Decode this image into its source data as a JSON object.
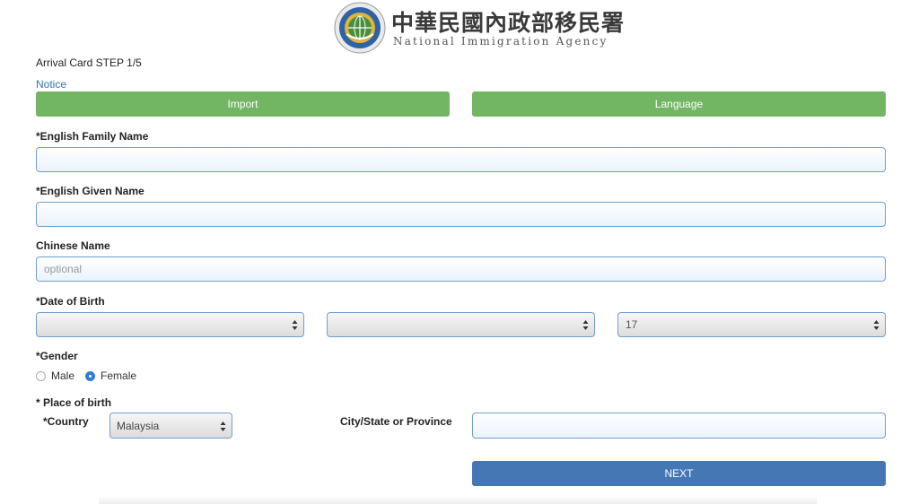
{
  "header": {
    "agency_name_zh": "中華民國內政部移民署",
    "agency_name_en": "National Immigration Agency",
    "logo_icon": "national-immigration-agency-seal-icon",
    "colors": {
      "seal_blue": "#2f63a8",
      "seal_gold": "#e2b53a",
      "seal_green": "#4a8d3c"
    }
  },
  "form": {
    "step": "Arrival Card STEP 1/5",
    "notice_link": "Notice",
    "import_button": "Import",
    "language_button": "Language",
    "family_name": {
      "label": "*English Family Name",
      "value": "",
      "placeholder": ""
    },
    "given_name": {
      "label": "*English Given Name",
      "value": "",
      "placeholder": ""
    },
    "chinese_name": {
      "label": "Chinese Name",
      "value": "",
      "placeholder": "optional"
    },
    "dob": {
      "label": "*Date of Birth",
      "year": "",
      "month": "",
      "day": "17"
    },
    "gender": {
      "label": "*Gender",
      "options": [
        {
          "label": "Male",
          "selected": false
        },
        {
          "label": "Female",
          "selected": true
        }
      ]
    },
    "place_of_birth": {
      "label": "* Place of birth",
      "country_label": "*Country",
      "country_value": "Malaysia",
      "city_label": "City/State or Province",
      "city_value": ""
    },
    "next_button": "NEXT"
  },
  "colors": {
    "green_button": "#72b563",
    "next_button": "#4677b5",
    "input_border": "#6f9fd0",
    "link": "#2f73b8",
    "radio_selected": "#2f7ce0"
  }
}
